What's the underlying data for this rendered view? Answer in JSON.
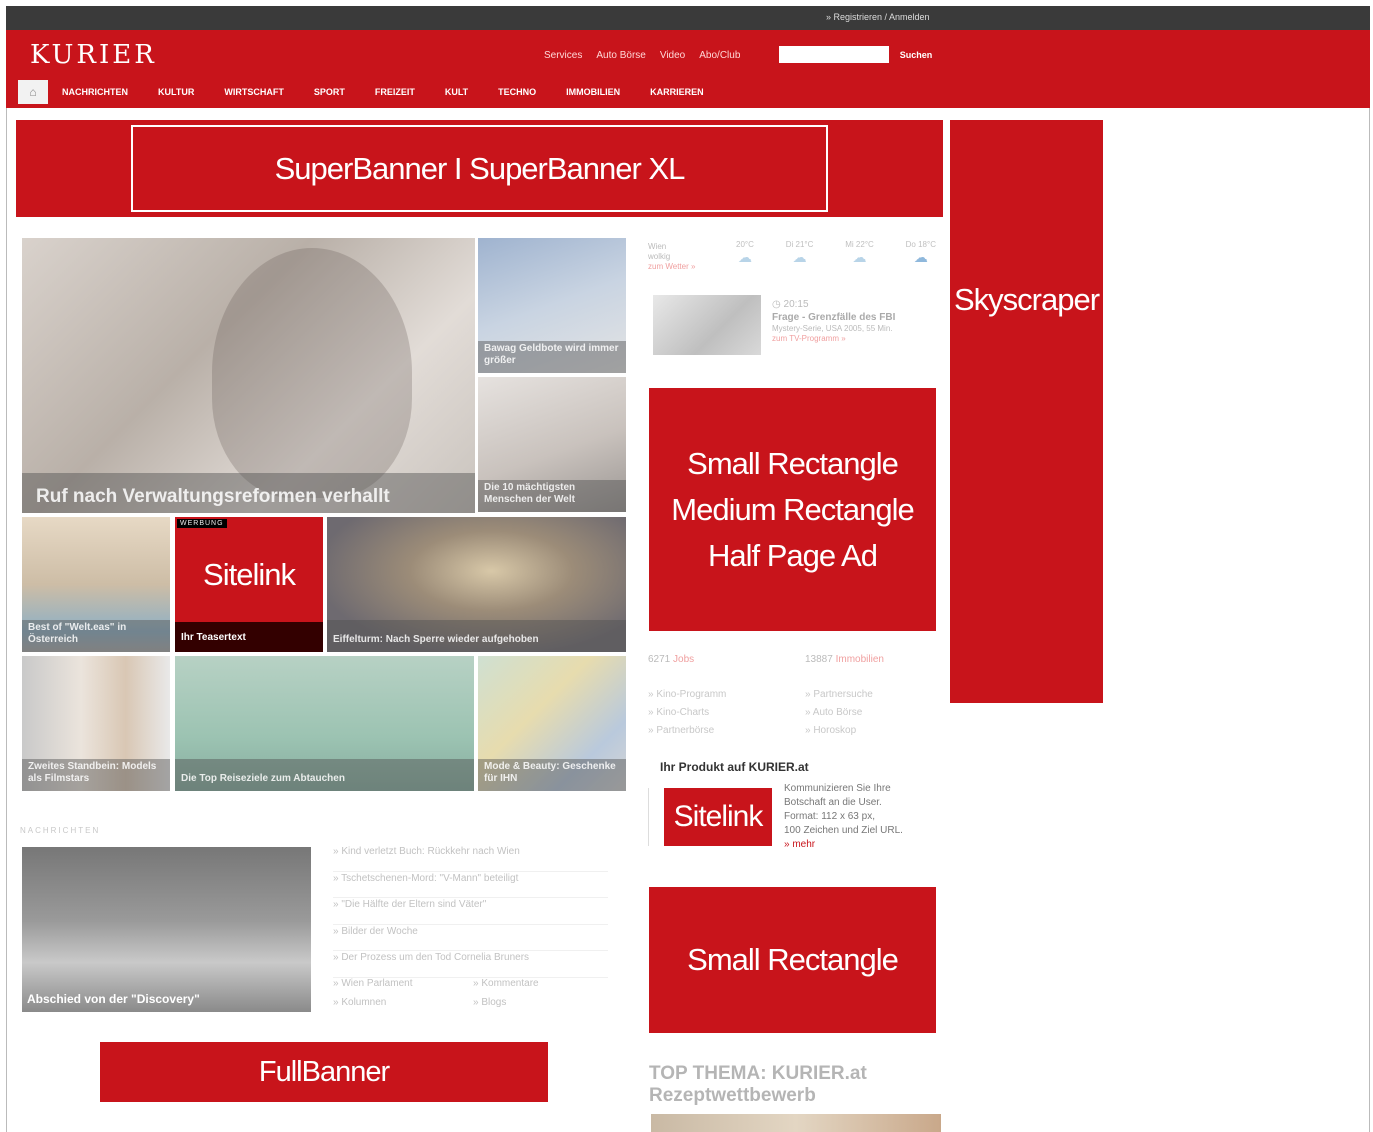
{
  "topbar": {
    "login_link": "» Registrieren / Anmelden"
  },
  "header": {
    "logo": "KURIER",
    "links": [
      "Services",
      "Auto Börse",
      "Video",
      "Abo/Club"
    ],
    "search_button": "Suchen",
    "nav": [
      "NACHRICHTEN",
      "KULTUR",
      "WIRTSCHAFT",
      "SPORT",
      "FREIZEIT",
      "KULT",
      "TECHNO",
      "IMMOBILIEN",
      "KARRIEREN"
    ]
  },
  "ads": {
    "superbanner": "SuperBanner I SuperBanner XL",
    "skyscraper": "Skyscraper",
    "rect_lines": [
      "Small Rectangle",
      "Medium Rectangle",
      "Half Page Ad"
    ],
    "small_rectangle": "Small Rectangle",
    "fullbanner": "FullBanner"
  },
  "teasers": {
    "main_caption": "Ruf nach Verwaltungsreformen verhallt",
    "tile1": "Bawag Geldbote wird immer größer",
    "tile2": "Die 10 mächtigsten Menschen der Welt",
    "tile3": "Best of \"Welt.eas\" in Österreich",
    "tile4": "Eiffelturm: Nach Sperre wieder aufgehoben",
    "tile5": "Zweites Standbein: Models als Filmstars",
    "tile6": "Die Top Reiseziele zum Abtauchen",
    "tile7": "Mode & Beauty: Geschenke für IHN"
  },
  "sitelink_tile": {
    "badge": "WERBUNG",
    "label": "Sitelink",
    "teaser": "Ihr Teasertext"
  },
  "weather": {
    "city": "Wien",
    "sub": "wolkig",
    "link": "zum Wetter »",
    "days": [
      "20°C",
      "Di 21°C",
      "Mi 22°C",
      "Do 18°C"
    ]
  },
  "tv": {
    "time": "20:15",
    "title": "Frage - Grenzfälle des FBI",
    "sub": "Mystery-Serie, USA 2005, 55 Min.",
    "link": "zum TV-Programm »"
  },
  "stats": {
    "jobs_count": "6271",
    "jobs_label": "Jobs",
    "immo_count": "13887",
    "immo_label": "Immobilien",
    "left": [
      "» Kino-Programm",
      "» Kino-Charts",
      "» Partnerbörse"
    ],
    "right": [
      "» Partnersuche",
      "» Auto Börse",
      "» Horoskop"
    ]
  },
  "produkt": {
    "title": "Ihr Produkt auf KURIER.at",
    "sitelink": "Sitelink",
    "desc": [
      "Kommunizieren Sie Ihre",
      "Botschaft an die User.",
      "Format: 112 x 63 px,",
      "100 Zeichen und Ziel URL."
    ],
    "more": "» mehr"
  },
  "topthema": {
    "line1": "TOP THEMA: KURIER.at",
    "line2": "Rezeptwettbewerb"
  },
  "nachrichten": {
    "section": "NACHRICHTEN",
    "image_caption": "Abschied von der \"Discovery\"",
    "list": [
      "» Kind verletzt Buch: Rückkehr nach Wien",
      "» Tschetschenen-Mord: \"V-Mann\" beteiligt",
      "» \"Die Hälfte der Eltern sind Väter\"",
      "» Bilder der Woche",
      "» Der Prozess um den Tod Cornelia Bruners"
    ],
    "sub": [
      "» Wien Parlament",
      "» Kommentare",
      "» Kolumnen",
      "» Blogs"
    ]
  }
}
